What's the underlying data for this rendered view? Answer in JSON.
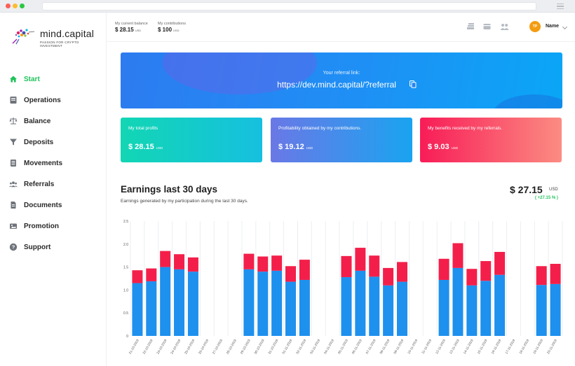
{
  "brand": {
    "name": "mind.capital",
    "tagline": "PASSION FOR CRYPTO INVESTMENT"
  },
  "header": {
    "balance_label": "My current balance",
    "balance_value": "$ 28.15",
    "balance_currency": "USD",
    "contrib_label": "My contributions",
    "contrib_value": "$ 100",
    "contrib_currency": "USD",
    "avatar_initials": "TP",
    "user_name": "Name"
  },
  "sidebar": {
    "items": [
      {
        "label": "Start",
        "icon": "home-icon",
        "active": true
      },
      {
        "label": "Operations",
        "icon": "ledger-icon",
        "active": false
      },
      {
        "label": "Balance",
        "icon": "scale-icon",
        "active": false
      },
      {
        "label": "Deposits",
        "icon": "filter-icon",
        "active": false
      },
      {
        "label": "Movements",
        "icon": "list-icon",
        "active": false
      },
      {
        "label": "Referrals",
        "icon": "users-icon",
        "active": false
      },
      {
        "label": "Documents",
        "icon": "document-icon",
        "active": false
      },
      {
        "label": "Promotion",
        "icon": "image-icon",
        "active": false
      },
      {
        "label": "Support",
        "icon": "help-icon",
        "active": false
      }
    ]
  },
  "referral": {
    "label": "Your referral link:",
    "url": "https://dev.mind.capital/?referral"
  },
  "cards": [
    {
      "title": "My total profits",
      "value": "$ 28.15",
      "currency": "USD",
      "gradient": [
        "#12d6b4",
        "#16c0df"
      ]
    },
    {
      "title": "Profitability obtained by my contributions.",
      "value": "$ 19.12",
      "currency": "USD",
      "gradient": [
        "#6a78e6",
        "#1aa4f0"
      ]
    },
    {
      "title": "My benefits received by my referrals.",
      "value": "$ 9.03",
      "currency": "USD",
      "gradient": [
        "#f81c57",
        "#fb8c82"
      ]
    }
  ],
  "earnings": {
    "title": "Earnings last 30 days",
    "subtitle": "Earnings generated by my participation during the last 30 days.",
    "total": "$ 27.15",
    "currency": "USD",
    "change": "( +27.15 % )"
  },
  "colors": {
    "accent": "#1fc35a",
    "bar_blue": "#1e90ee",
    "bar_red": "#f31f4a"
  },
  "chart_data": {
    "type": "bar",
    "stacked": true,
    "categories": [
      "21-10-2019",
      "22-10-2019",
      "23-10-2019",
      "24-10-2019",
      "25-10-2019",
      "26-10-2019",
      "27-10-2019",
      "28-10-2019",
      "29-10-2019",
      "30-10-2019",
      "31-10-2019",
      "01-11-2019",
      "02-11-2019",
      "03-11-2019",
      "04-11-2019",
      "05-11-2019",
      "06-11-2019",
      "07-11-2019",
      "08-11-2019",
      "09-11-2019",
      "10-11-2019",
      "11-11-2019",
      "12-11-2019",
      "13-11-2019",
      "14-11-2019",
      "15-11-2019",
      "16-11-2019",
      "17-11-2019",
      "18-11-2019",
      "19-11-2019",
      "20-11-2019"
    ],
    "series": [
      {
        "color": "#1e90ee",
        "values": [
          1.15,
          1.19,
          1.5,
          1.45,
          1.4,
          0,
          0,
          0,
          1.45,
          1.4,
          1.42,
          1.18,
          1.22,
          0,
          0,
          1.28,
          1.42,
          1.29,
          1.1,
          1.18,
          0,
          0,
          1.22,
          1.48,
          1.1,
          1.2,
          1.33,
          0,
          0,
          1.11,
          1.13
        ]
      },
      {
        "color": "#f31f4a",
        "values": [
          0.28,
          0.28,
          0.35,
          0.33,
          0.31,
          0,
          0,
          0,
          0.34,
          0.33,
          0.33,
          0.34,
          0.44,
          0,
          0,
          0.46,
          0.5,
          0.46,
          0.38,
          0.43,
          0,
          0,
          0.46,
          0.54,
          0.36,
          0.43,
          0.5,
          0,
          0,
          0.41,
          0.44
        ]
      }
    ],
    "yticks": [
      "0",
      "0.5",
      "1.0",
      "1.5",
      "2.0",
      "2.5"
    ],
    "ylim": [
      0,
      2.5
    ],
    "grid": "vertical",
    "legend": "none"
  }
}
